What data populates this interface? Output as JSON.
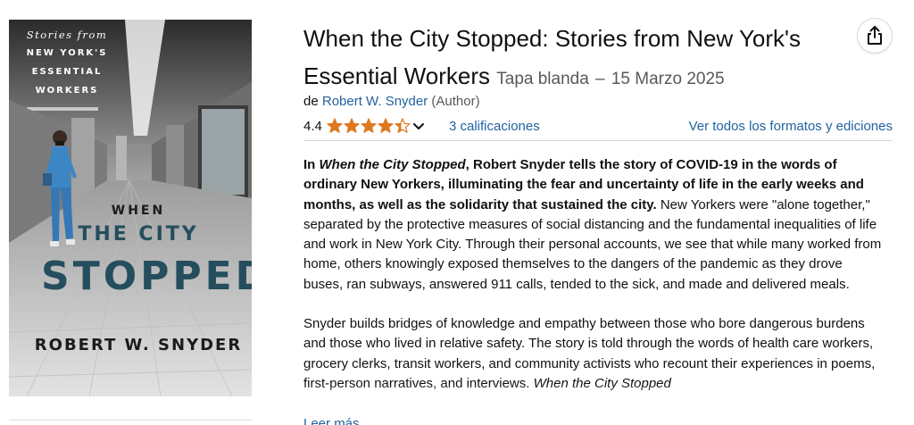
{
  "cover": {
    "tagline": "Stories from",
    "subtitle_line1": "NEW YORK'S",
    "subtitle_line2": "ESSENTIAL",
    "subtitle_line3": "WORKERS",
    "word_when": "WHEN",
    "word_the_city": "THE CITY",
    "word_stopped": "STOPPED",
    "author": "ROBERT W. SNYDER"
  },
  "product": {
    "title": "When the City Stopped: Stories from New York's Essential Workers",
    "format": "Tapa blanda",
    "separator": "–",
    "date": "15 Marzo 2025",
    "by_prefix": "de",
    "author": "Robert W. Snyder",
    "author_role": "(Author)",
    "rating": "4.4",
    "rating_value": 4.4,
    "ratings_count_text": "3 calificaciones",
    "formats_link": "Ver todos los formatos y ediciones",
    "share_icon": "share-icon"
  },
  "description": {
    "p1_intro": "In ",
    "p1_title_italic": "When the City Stopped",
    "p1_bold_rest": ", Robert Snyder tells the story of COVID-19 in the words of ordinary New Yorkers, illuminating the fear and uncertainty of life in the early weeks and months, as well as the solidarity that sustained the city.",
    "p1_normal": " New Yorkers were \"alone together,\" separated by the protective measures of social distancing and the fundamental inequalities of life and work in New York City. Through their personal accounts, we see that while many worked from home, others knowingly exposed themselves to the dangers of the pandemic as they drove buses, ran subways, answered 911 calls, tended to the sick, and made and delivered meals.",
    "p2_normal": "Snyder builds bridges of knowledge and empathy between those who bore dangerous burdens and those who lived in relative safety. The story is told through the words of health care workers, grocery clerks, transit workers, and community activists who recount their experiences in poems, first-person narratives, and interviews. ",
    "p2_italic": "When the City Stopped",
    "read_more": "Leer más"
  },
  "colors": {
    "link": "#2162a1",
    "star": "#de7921",
    "cover_accent": "#244e5d",
    "text": "#0f1111",
    "muted": "#565959"
  }
}
